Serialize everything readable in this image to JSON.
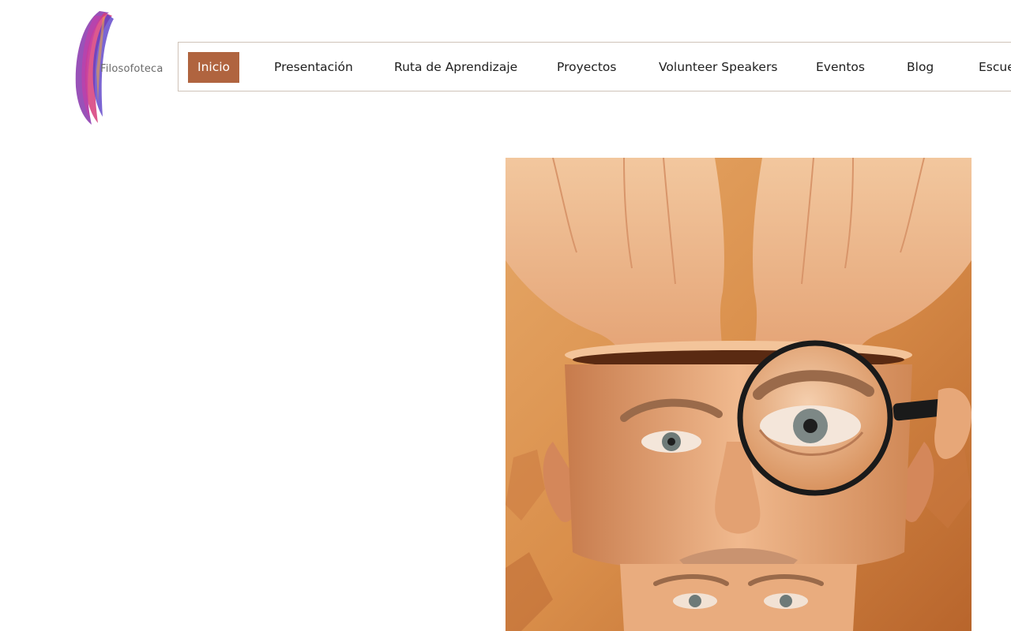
{
  "brand": {
    "name": "Filosofoteca"
  },
  "nav": {
    "items": [
      {
        "label": "Inicio",
        "active": true
      },
      {
        "label": "Presentación"
      },
      {
        "label": "Ruta de Aprendizaje"
      },
      {
        "label": "Proyectos"
      },
      {
        "label": "Volunteer Speakers"
      },
      {
        "label": "Eventos"
      },
      {
        "label": "Blog"
      },
      {
        "label": "Escue"
      }
    ]
  },
  "colors": {
    "accent": "#b0643f",
    "nav_border": "#cfc3b8"
  }
}
